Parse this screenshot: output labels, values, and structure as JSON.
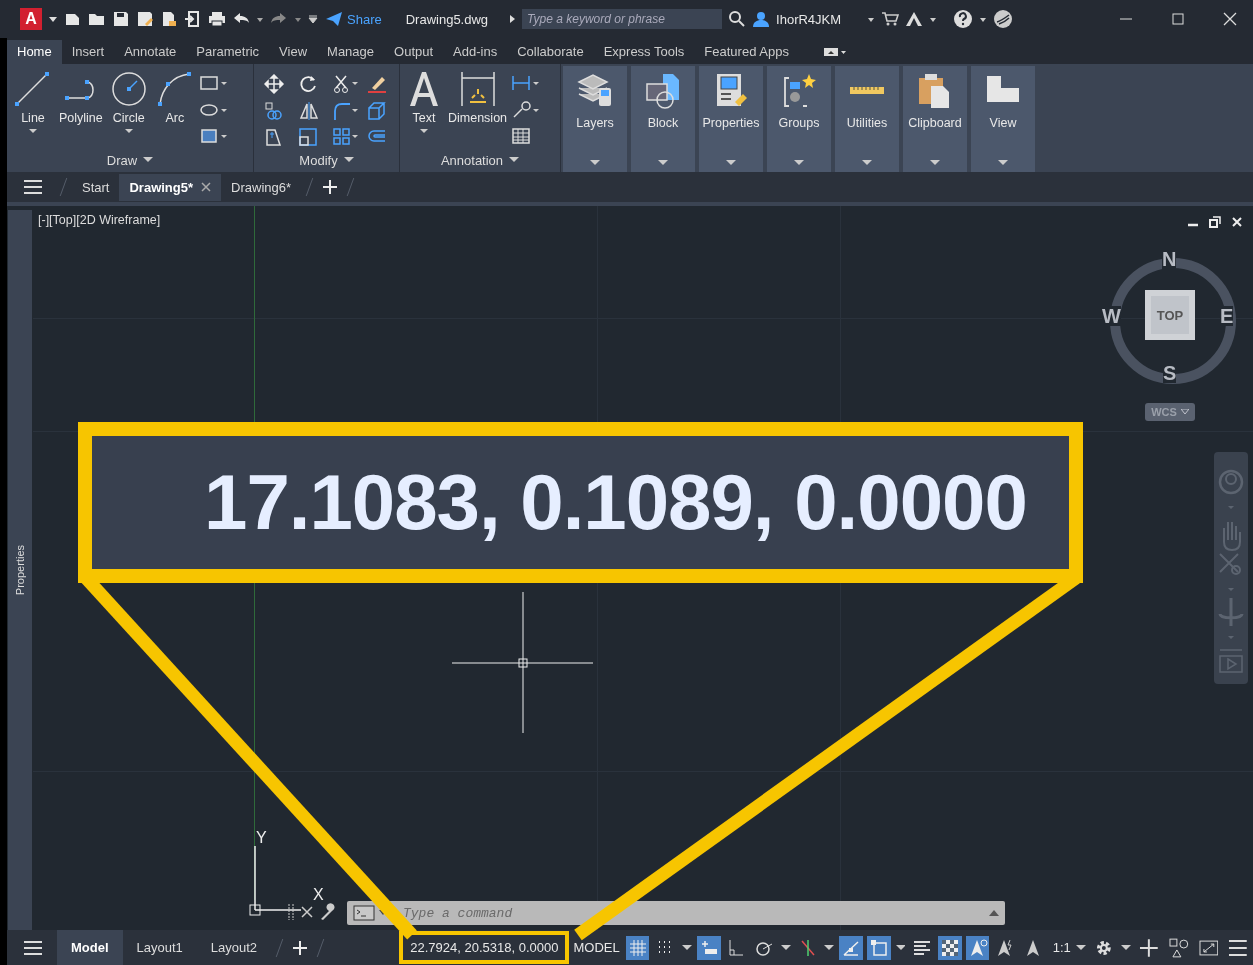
{
  "app": {
    "logo": "A",
    "share": "Share",
    "file_name": "Drawing5.dwg",
    "search": {
      "placeholder": "Type a keyword or phrase"
    },
    "user": "IhorR4JKM"
  },
  "ribbon_tabs": [
    {
      "label": "Home",
      "selected": true
    },
    {
      "label": "Insert",
      "selected": false
    },
    {
      "label": "Annotate",
      "selected": false
    },
    {
      "label": "Parametric",
      "selected": false
    },
    {
      "label": "View",
      "selected": false
    },
    {
      "label": "Manage",
      "selected": false
    },
    {
      "label": "Output",
      "selected": false
    },
    {
      "label": "Add-ins",
      "selected": false
    },
    {
      "label": "Collaborate",
      "selected": false
    },
    {
      "label": "Express Tools",
      "selected": false
    },
    {
      "label": "Featured Apps",
      "selected": false
    }
  ],
  "ribbon_panels": [
    {
      "title": "Draw",
      "tools": [
        "Line",
        "Polyline",
        "Circle",
        "Arc"
      ]
    },
    {
      "title": "Modify"
    },
    {
      "title": "Annotation",
      "tools": [
        "Text",
        "Dimension"
      ]
    }
  ],
  "ribbon_groups": [
    "Layers",
    "Block",
    "Properties",
    "Groups",
    "Utilities",
    "Clipboard",
    "View"
  ],
  "doc_tabs": [
    {
      "label": "Start",
      "selected": false
    },
    {
      "label": "Drawing5*",
      "selected": true
    },
    {
      "label": "Drawing6*",
      "selected": false
    }
  ],
  "viewport": {
    "label": "[-][Top][2D Wireframe]",
    "side_palette": "Properties",
    "viewcube": {
      "north": "N",
      "south": "S",
      "east": "E",
      "west": "W",
      "face": "TOP",
      "ucs": "WCS"
    },
    "ucs_icon": {
      "x": "X",
      "y": "Y"
    }
  },
  "command_line": {
    "placeholder": "Type a command"
  },
  "layout_tabs": [
    {
      "label": "Model",
      "selected": true
    },
    {
      "label": "Layout1",
      "selected": false
    },
    {
      "label": "Layout2",
      "selected": false
    }
  ],
  "status_bar": {
    "coordinates": "22.7924, 20.5318, 0.0000",
    "space": "MODEL",
    "scale": "1:1",
    "toggles": [
      {
        "kind": "grid",
        "on": true,
        "dropdown": false
      },
      {
        "kind": "snap",
        "on": false,
        "dropdown": true
      },
      {
        "kind": "infer",
        "on": true,
        "dropdown": false
      },
      {
        "kind": "ortho",
        "on": false,
        "dropdown": false
      },
      {
        "kind": "polar",
        "on": false,
        "dropdown": true
      },
      {
        "kind": "isodraft",
        "on": false,
        "dropdown": true
      },
      {
        "kind": "track",
        "on": true,
        "dropdown": false
      },
      {
        "kind": "osnap",
        "on": true,
        "dropdown": true
      },
      {
        "kind": "lineweight",
        "on": false,
        "dropdown": false
      },
      {
        "kind": "transparency",
        "on": true,
        "dropdown": false
      },
      {
        "kind": "annovis",
        "on": true,
        "dropdown": false
      },
      {
        "kind": "autoscale",
        "on": false,
        "dropdown": false
      },
      {
        "kind": "annoscale",
        "on": false,
        "dropdown": false
      }
    ]
  },
  "callout": {
    "text": "17.1083, 0.1089, 0.0000"
  }
}
